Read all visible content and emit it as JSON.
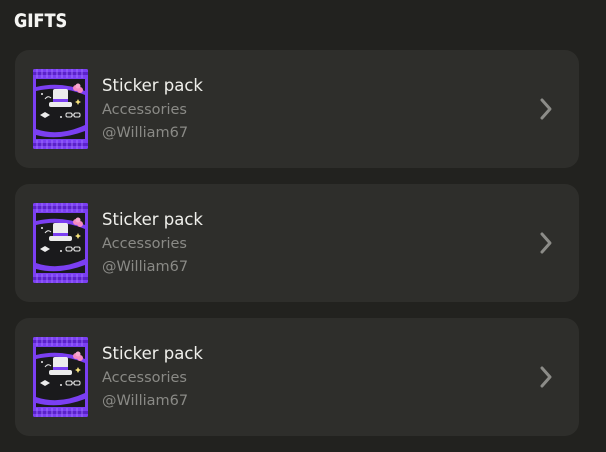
{
  "section": {
    "title": "GIFTS"
  },
  "gifts": [
    {
      "title": "Sticker pack",
      "category": "Accessories",
      "sender": "@William67",
      "thumbnail_icon": "sticker-pack-icon",
      "action_icon": "chevron-right-icon"
    },
    {
      "title": "Sticker pack",
      "category": "Accessories",
      "sender": "@William67",
      "thumbnail_icon": "sticker-pack-icon",
      "action_icon": "chevron-right-icon"
    },
    {
      "title": "Sticker pack",
      "category": "Accessories",
      "sender": "@William67",
      "thumbnail_icon": "sticker-pack-icon",
      "action_icon": "chevron-right-icon"
    }
  ],
  "colors": {
    "background": "#22221f",
    "card": "#2e2e2b",
    "title_text": "#f0f0ec",
    "secondary_text": "#8a8a86",
    "pack_purple": "#7b3ff2",
    "chevron": "#8c8c88"
  }
}
